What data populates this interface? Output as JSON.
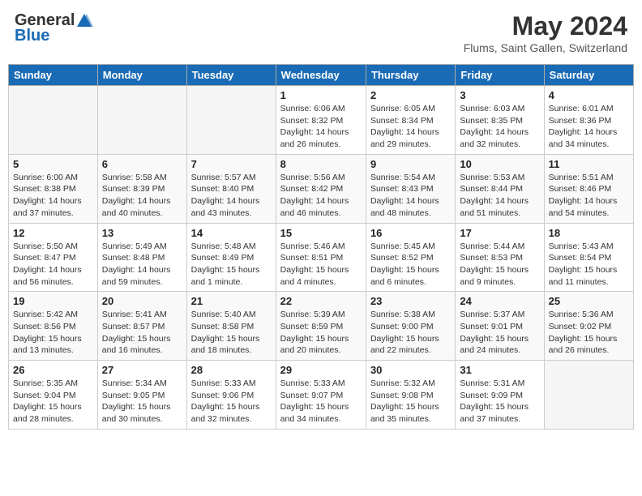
{
  "header": {
    "logo_general": "General",
    "logo_blue": "Blue",
    "title": "May 2024",
    "subtitle": "Flums, Saint Gallen, Switzerland"
  },
  "weekdays": [
    "Sunday",
    "Monday",
    "Tuesday",
    "Wednesday",
    "Thursday",
    "Friday",
    "Saturday"
  ],
  "weeks": [
    [
      {
        "day": "",
        "info": ""
      },
      {
        "day": "",
        "info": ""
      },
      {
        "day": "",
        "info": ""
      },
      {
        "day": "1",
        "info": "Sunrise: 6:06 AM\nSunset: 8:32 PM\nDaylight: 14 hours and 26 minutes."
      },
      {
        "day": "2",
        "info": "Sunrise: 6:05 AM\nSunset: 8:34 PM\nDaylight: 14 hours and 29 minutes."
      },
      {
        "day": "3",
        "info": "Sunrise: 6:03 AM\nSunset: 8:35 PM\nDaylight: 14 hours and 32 minutes."
      },
      {
        "day": "4",
        "info": "Sunrise: 6:01 AM\nSunset: 8:36 PM\nDaylight: 14 hours and 34 minutes."
      }
    ],
    [
      {
        "day": "5",
        "info": "Sunrise: 6:00 AM\nSunset: 8:38 PM\nDaylight: 14 hours and 37 minutes."
      },
      {
        "day": "6",
        "info": "Sunrise: 5:58 AM\nSunset: 8:39 PM\nDaylight: 14 hours and 40 minutes."
      },
      {
        "day": "7",
        "info": "Sunrise: 5:57 AM\nSunset: 8:40 PM\nDaylight: 14 hours and 43 minutes."
      },
      {
        "day": "8",
        "info": "Sunrise: 5:56 AM\nSunset: 8:42 PM\nDaylight: 14 hours and 46 minutes."
      },
      {
        "day": "9",
        "info": "Sunrise: 5:54 AM\nSunset: 8:43 PM\nDaylight: 14 hours and 48 minutes."
      },
      {
        "day": "10",
        "info": "Sunrise: 5:53 AM\nSunset: 8:44 PM\nDaylight: 14 hours and 51 minutes."
      },
      {
        "day": "11",
        "info": "Sunrise: 5:51 AM\nSunset: 8:46 PM\nDaylight: 14 hours and 54 minutes."
      }
    ],
    [
      {
        "day": "12",
        "info": "Sunrise: 5:50 AM\nSunset: 8:47 PM\nDaylight: 14 hours and 56 minutes."
      },
      {
        "day": "13",
        "info": "Sunrise: 5:49 AM\nSunset: 8:48 PM\nDaylight: 14 hours and 59 minutes."
      },
      {
        "day": "14",
        "info": "Sunrise: 5:48 AM\nSunset: 8:49 PM\nDaylight: 15 hours and 1 minute."
      },
      {
        "day": "15",
        "info": "Sunrise: 5:46 AM\nSunset: 8:51 PM\nDaylight: 15 hours and 4 minutes."
      },
      {
        "day": "16",
        "info": "Sunrise: 5:45 AM\nSunset: 8:52 PM\nDaylight: 15 hours and 6 minutes."
      },
      {
        "day": "17",
        "info": "Sunrise: 5:44 AM\nSunset: 8:53 PM\nDaylight: 15 hours and 9 minutes."
      },
      {
        "day": "18",
        "info": "Sunrise: 5:43 AM\nSunset: 8:54 PM\nDaylight: 15 hours and 11 minutes."
      }
    ],
    [
      {
        "day": "19",
        "info": "Sunrise: 5:42 AM\nSunset: 8:56 PM\nDaylight: 15 hours and 13 minutes."
      },
      {
        "day": "20",
        "info": "Sunrise: 5:41 AM\nSunset: 8:57 PM\nDaylight: 15 hours and 16 minutes."
      },
      {
        "day": "21",
        "info": "Sunrise: 5:40 AM\nSunset: 8:58 PM\nDaylight: 15 hours and 18 minutes."
      },
      {
        "day": "22",
        "info": "Sunrise: 5:39 AM\nSunset: 8:59 PM\nDaylight: 15 hours and 20 minutes."
      },
      {
        "day": "23",
        "info": "Sunrise: 5:38 AM\nSunset: 9:00 PM\nDaylight: 15 hours and 22 minutes."
      },
      {
        "day": "24",
        "info": "Sunrise: 5:37 AM\nSunset: 9:01 PM\nDaylight: 15 hours and 24 minutes."
      },
      {
        "day": "25",
        "info": "Sunrise: 5:36 AM\nSunset: 9:02 PM\nDaylight: 15 hours and 26 minutes."
      }
    ],
    [
      {
        "day": "26",
        "info": "Sunrise: 5:35 AM\nSunset: 9:04 PM\nDaylight: 15 hours and 28 minutes."
      },
      {
        "day": "27",
        "info": "Sunrise: 5:34 AM\nSunset: 9:05 PM\nDaylight: 15 hours and 30 minutes."
      },
      {
        "day": "28",
        "info": "Sunrise: 5:33 AM\nSunset: 9:06 PM\nDaylight: 15 hours and 32 minutes."
      },
      {
        "day": "29",
        "info": "Sunrise: 5:33 AM\nSunset: 9:07 PM\nDaylight: 15 hours and 34 minutes."
      },
      {
        "day": "30",
        "info": "Sunrise: 5:32 AM\nSunset: 9:08 PM\nDaylight: 15 hours and 35 minutes."
      },
      {
        "day": "31",
        "info": "Sunrise: 5:31 AM\nSunset: 9:09 PM\nDaylight: 15 hours and 37 minutes."
      },
      {
        "day": "",
        "info": ""
      }
    ]
  ],
  "colors": {
    "header_bg": "#1a6bb5",
    "logo_blue": "#1a6bb5"
  }
}
